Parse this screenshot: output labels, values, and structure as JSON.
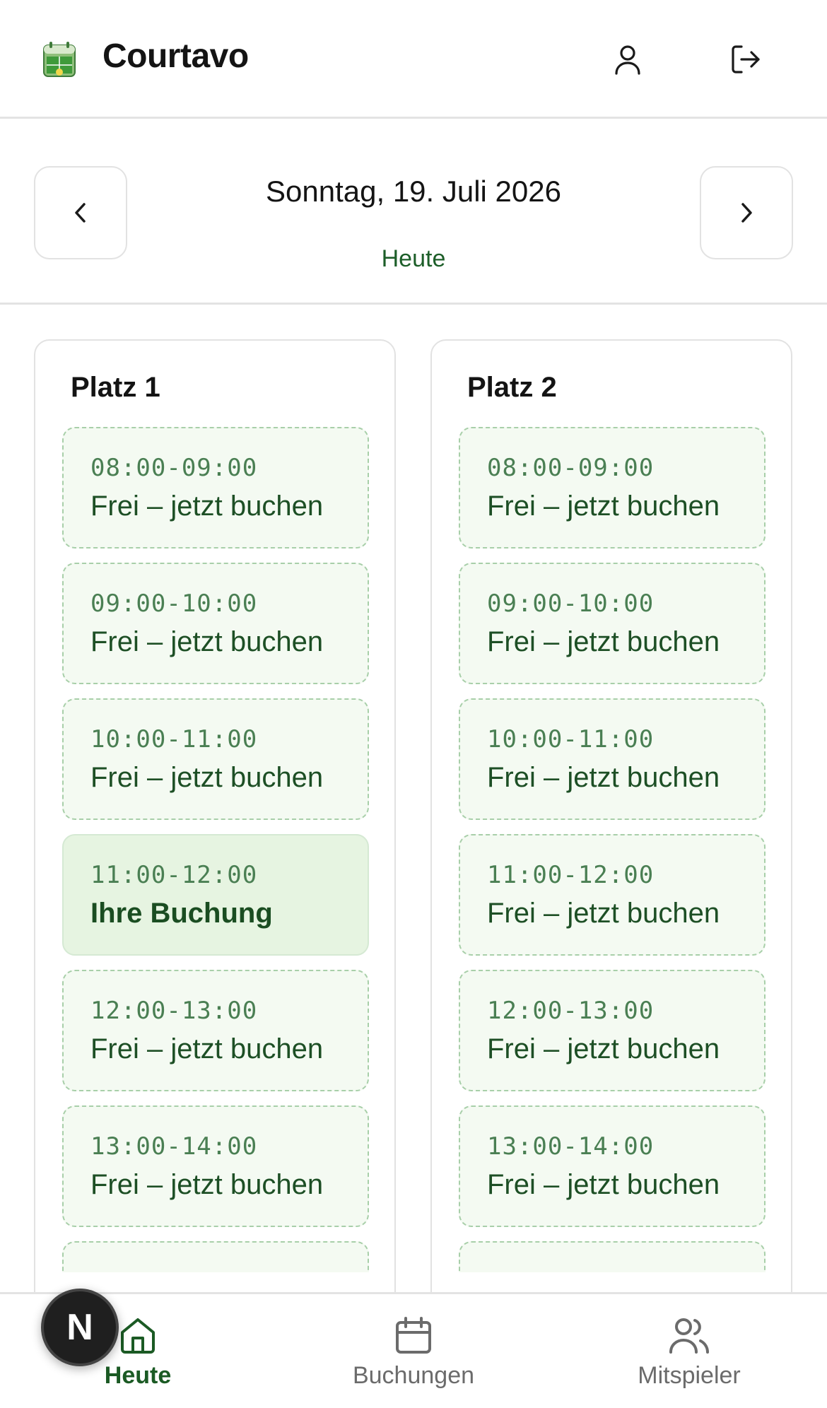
{
  "header": {
    "title": "Courtavo",
    "logo_icon": "calendar-court-logo",
    "user_icon": "user-icon",
    "logout_icon": "logout-icon"
  },
  "date_nav": {
    "date_label": "Sonntag, 19. Juli 2026",
    "today_label": "Heute",
    "prev_icon": "chevron-left-icon",
    "next_icon": "chevron-right-icon"
  },
  "courts": [
    {
      "name": "Platz 1",
      "slots": [
        {
          "time": "08:00-09:00",
          "status": "Frei – jetzt buchen",
          "mine": false
        },
        {
          "time": "09:00-10:00",
          "status": "Frei – jetzt buchen",
          "mine": false
        },
        {
          "time": "10:00-11:00",
          "status": "Frei – jetzt buchen",
          "mine": false
        },
        {
          "time": "11:00-12:00",
          "status": "Ihre Buchung",
          "mine": true
        },
        {
          "time": "12:00-13:00",
          "status": "Frei – jetzt buchen",
          "mine": false
        },
        {
          "time": "13:00-14:00",
          "status": "Frei – jetzt buchen",
          "mine": false
        }
      ]
    },
    {
      "name": "Platz 2",
      "slots": [
        {
          "time": "08:00-09:00",
          "status": "Frei – jetzt buchen",
          "mine": false
        },
        {
          "time": "09:00-10:00",
          "status": "Frei – jetzt buchen",
          "mine": false
        },
        {
          "time": "10:00-11:00",
          "status": "Frei – jetzt buchen",
          "mine": false
        },
        {
          "time": "11:00-12:00",
          "status": "Frei – jetzt buchen",
          "mine": false
        },
        {
          "time": "12:00-13:00",
          "status": "Frei – jetzt buchen",
          "mine": false
        },
        {
          "time": "13:00-14:00",
          "status": "Frei – jetzt buchen",
          "mine": false
        }
      ]
    }
  ],
  "bottom_nav": {
    "items": [
      {
        "label": "Heute",
        "icon": "home-icon",
        "active": true
      },
      {
        "label": "Buchungen",
        "icon": "calendar-icon",
        "active": false
      },
      {
        "label": "Mitspieler",
        "icon": "users-icon",
        "active": false
      }
    ]
  },
  "dev_badge": {
    "letter": "N"
  },
  "colors": {
    "accent": "#1b5a24",
    "slot_free_bg": "#f4faf2",
    "slot_free_border": "#a8cfa9",
    "slot_mine_bg": "#e6f4e1"
  }
}
